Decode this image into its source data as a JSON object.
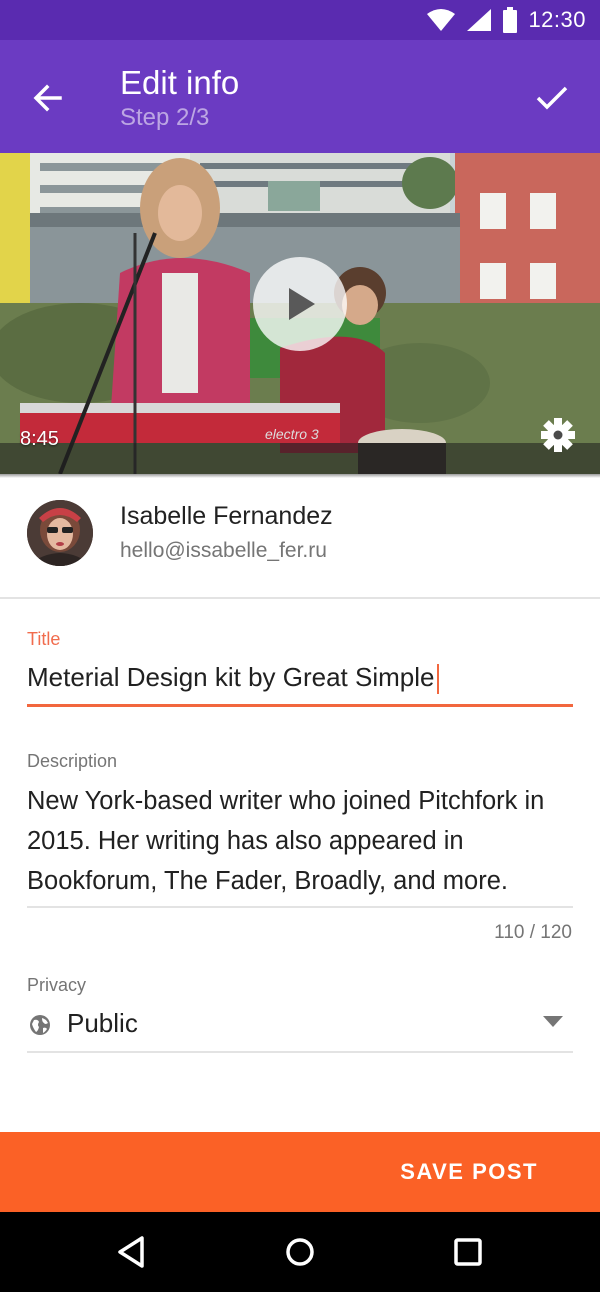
{
  "status_bar": {
    "time": "12:30"
  },
  "app_bar": {
    "title": "Edit info",
    "subtitle": "Step 2/3"
  },
  "video": {
    "duration": "8:45",
    "keyboard_brand": "electro 3"
  },
  "profile": {
    "name": "Isabelle Fernandez",
    "email": "hello@issabelle_fer.ru"
  },
  "form": {
    "title_label": "Title",
    "title_value": "Meterial Design kit by Great Simple",
    "description_label": "Description",
    "description_value": "New York-based writer who joined Pitchfork in 2015. Her writing has also appeared in Bookforum, The Fader, Broadly, and more.",
    "char_counter": "110 / 120",
    "privacy_label": "Privacy",
    "privacy_value": "Public"
  },
  "actions": {
    "save_label": "SAVE POST"
  },
  "colors": {
    "status_bar": "#5a2bb0",
    "app_bar": "#6b3bc2",
    "accent": "#f2673e",
    "save_bar": "#fb6126"
  },
  "icons": {
    "back": "arrow-left-icon",
    "confirm": "check-icon",
    "play": "play-icon",
    "settings": "gear-icon",
    "privacy": "globe-icon",
    "dropdown": "caret-down-icon",
    "nav_back": "triangle-back-icon",
    "nav_home": "circle-home-icon",
    "nav_recents": "square-recents-icon"
  }
}
